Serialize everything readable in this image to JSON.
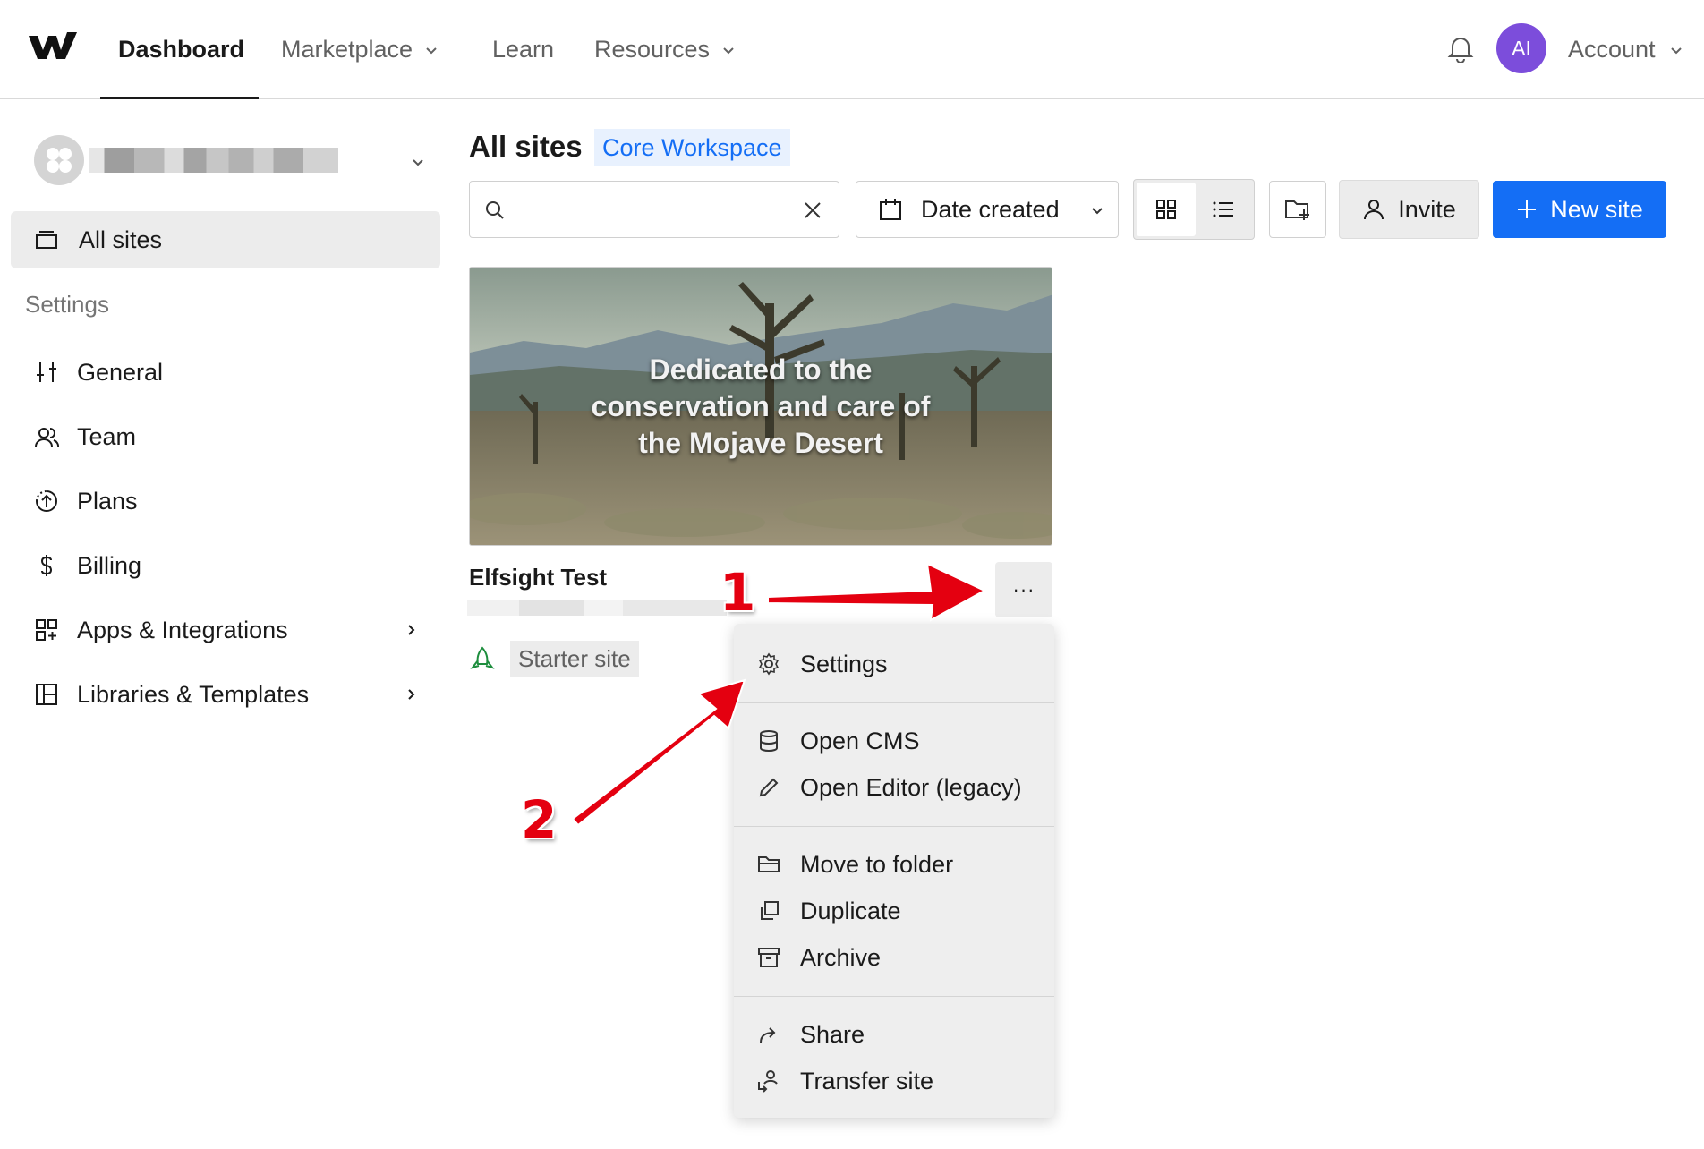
{
  "nav": {
    "dashboard": "Dashboard",
    "marketplace": "Marketplace",
    "learn": "Learn",
    "resources": "Resources",
    "avatar_initials": "AI",
    "account": "Account"
  },
  "sidebar": {
    "all_sites": "All sites",
    "settings_heading": "Settings",
    "items": [
      {
        "label": "General",
        "icon": "sliders-icon"
      },
      {
        "label": "Team",
        "icon": "users-icon"
      },
      {
        "label": "Plans",
        "icon": "plans-icon"
      },
      {
        "label": "Billing",
        "icon": "dollar-icon"
      },
      {
        "label": "Apps & Integrations",
        "icon": "apps-icon"
      },
      {
        "label": "Libraries & Templates",
        "icon": "libraries-icon"
      }
    ]
  },
  "main": {
    "title": "All sites",
    "workspace": "Core Workspace",
    "search_value": "",
    "sort_label": "Date created",
    "invite_label": "Invite",
    "new_site_label": "New site"
  },
  "site": {
    "thumbnail_text": "Dedicated to the conservation and care of the Mojave Desert",
    "thumbnail_lines": [
      "Dedicated to the",
      "conservation and care of",
      "the Mojave Desert"
    ],
    "name": "Elfsight Test",
    "plan_tag": "Starter site",
    "more_label": "···"
  },
  "menu": {
    "items": [
      {
        "label": "Settings",
        "icon": "gear-icon"
      },
      {
        "label": "Open CMS",
        "icon": "database-icon"
      },
      {
        "label": "Open Editor (legacy)",
        "icon": "pencil-icon"
      },
      {
        "label": "Move to folder",
        "icon": "folder-icon"
      },
      {
        "label": "Duplicate",
        "icon": "duplicate-icon"
      },
      {
        "label": "Archive",
        "icon": "archive-icon"
      },
      {
        "label": "Share",
        "icon": "share-icon"
      },
      {
        "label": "Transfer site",
        "icon": "transfer-icon"
      }
    ]
  },
  "annotations": {
    "step1": "1",
    "step2": "2"
  },
  "colors": {
    "accent": "#146ef5",
    "avatar": "#7c4ddb",
    "annotation": "#e40010",
    "starter_icon": "#1e8e3e"
  }
}
